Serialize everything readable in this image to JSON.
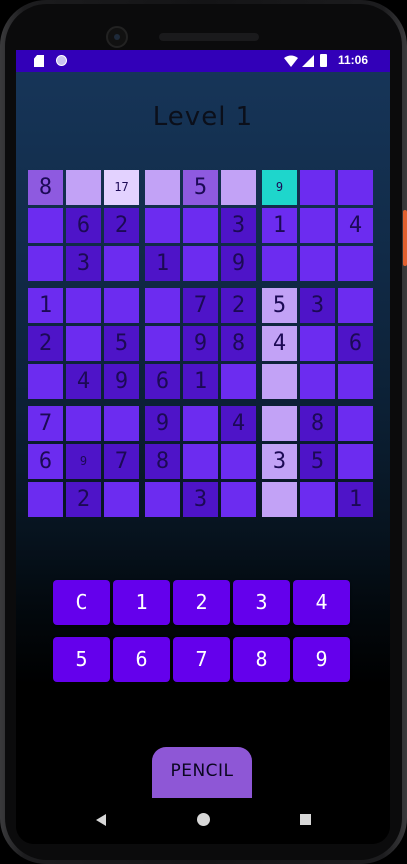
{
  "status_bar": {
    "time": "11:06",
    "icons": [
      "sd-card-icon",
      "sync-circle-icon",
      "wifi-icon",
      "signal-icon",
      "battery-icon"
    ]
  },
  "title": "Level 1",
  "colors": {
    "header": "#3200b8",
    "key": "#6400ec",
    "pencil": "#8e57d6",
    "selected": "#1ed6cc"
  },
  "board": {
    "rows": [
      [
        "8",
        "",
        "17",
        "",
        "5",
        "",
        "9",
        "",
        ""
      ],
      [
        "",
        "6",
        "2",
        "",
        "",
        "3",
        "1",
        "",
        "4"
      ],
      [
        "",
        "3",
        "",
        "1",
        "",
        "9",
        "",
        "",
        ""
      ],
      [
        "1",
        "",
        "",
        "",
        "7",
        "2",
        "5",
        "3",
        ""
      ],
      [
        "2",
        "",
        "5",
        "",
        "9",
        "8",
        "4",
        "",
        "6"
      ],
      [
        "",
        "4",
        "9",
        "6",
        "1",
        "",
        "",
        "",
        ""
      ],
      [
        "7",
        "",
        "",
        "9",
        "",
        "4",
        "",
        "8",
        ""
      ],
      [
        "6",
        "9",
        "7",
        "8",
        "",
        "",
        "3",
        "5",
        ""
      ],
      [
        "",
        "2",
        "",
        "",
        "3",
        "",
        "",
        "",
        "1"
      ]
    ],
    "small_cells": [
      "0-2",
      "0-6",
      "7-1"
    ]
  },
  "keypad": {
    "rows": [
      [
        "C",
        "1",
        "2",
        "3",
        "4"
      ],
      [
        "5",
        "6",
        "7",
        "8",
        "9"
      ]
    ]
  },
  "pencil_label": "PENCIL",
  "nav": [
    "back-icon",
    "home-icon",
    "recents-icon"
  ]
}
